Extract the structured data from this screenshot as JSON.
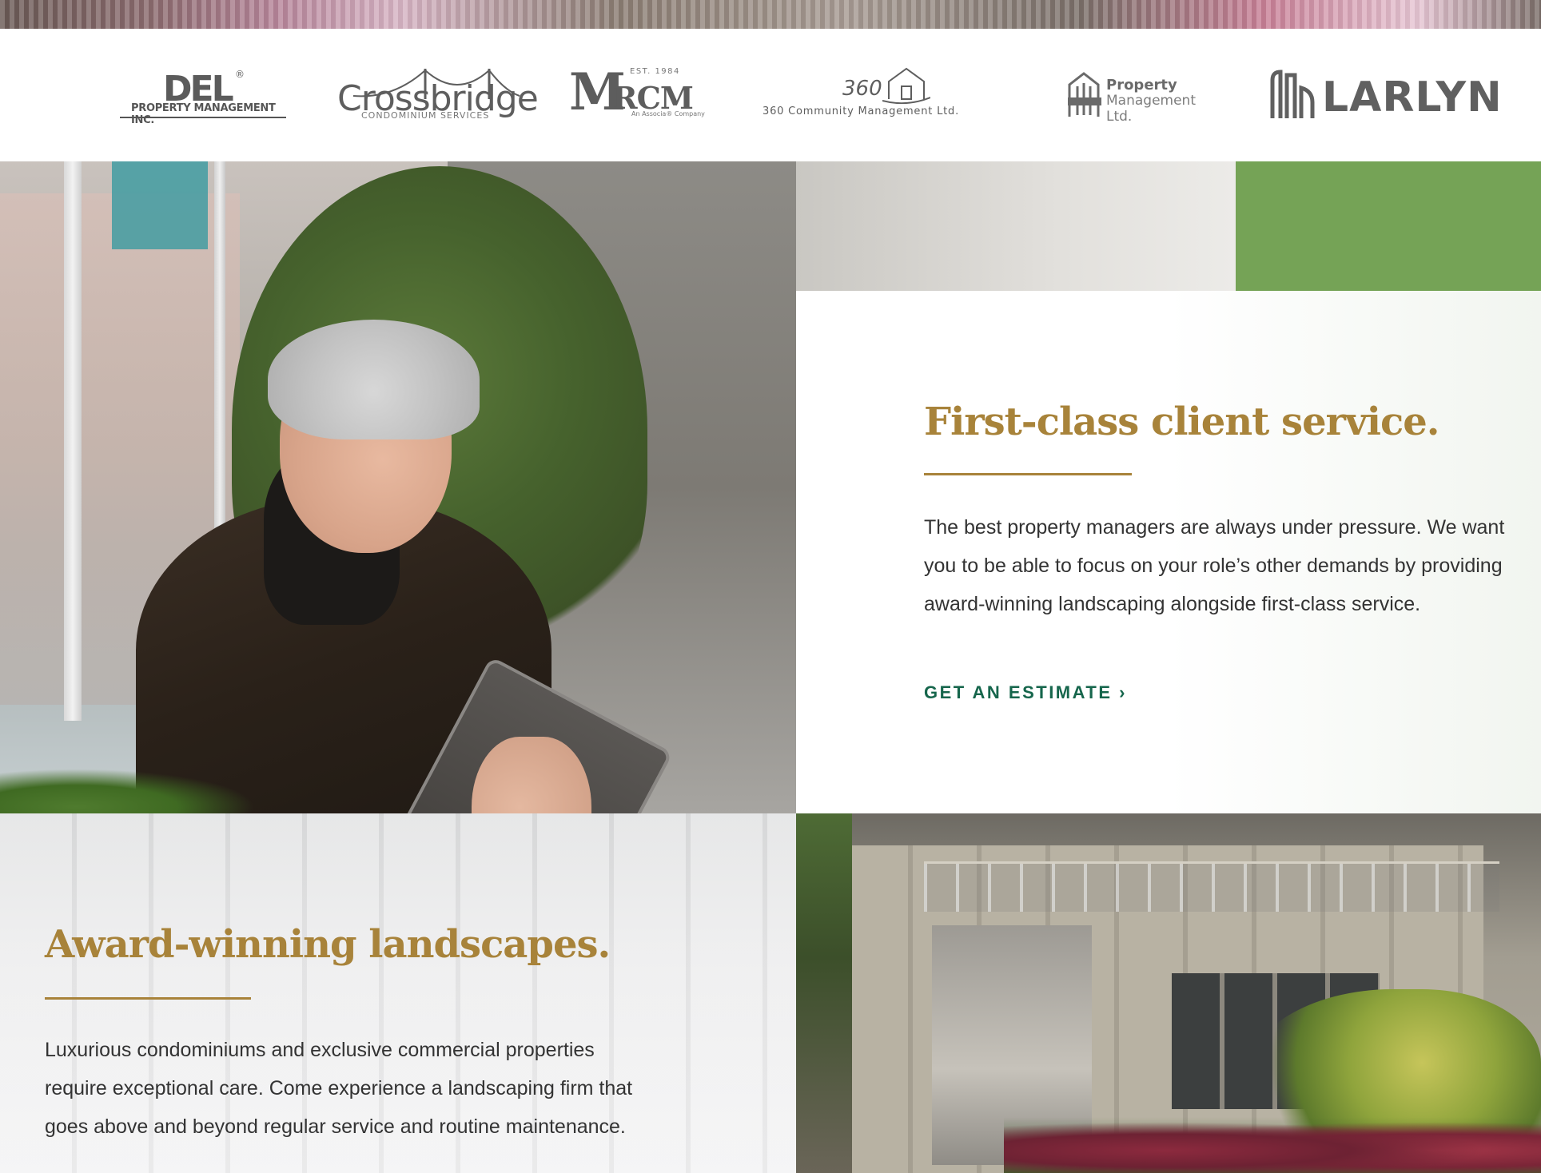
{
  "logos": {
    "del": {
      "mark": "DEL",
      "reg": "®",
      "tagline": "PROPERTY MANAGEMENT INC."
    },
    "crossbridge": {
      "name": "Crossbridge",
      "sub": "CONDOMINIUM SERVICES"
    },
    "mrcm": {
      "m": "M",
      "rcm": "RCM",
      "est": "EST. 1984",
      "assoc": "An Associa® Company"
    },
    "c360": {
      "num": "360",
      "name": "360 Community Management Ltd."
    },
    "icc": {
      "line1": "Property",
      "line2": "Management Ltd."
    },
    "larlyn": {
      "name": "LARLYN"
    }
  },
  "section_service": {
    "heading": "First-class client service.",
    "body": "The best property managers are always under pressure. We want you to be able to focus on your role’s other demands by providing award-winning landscaping alongside first-class service.",
    "cta_label": "GET AN ESTIMATE ›"
  },
  "section_landscapes": {
    "heading": "Award-winning landscapes.",
    "body": "Luxurious condominiums and exclusive commercial properties require exceptional care. Come experience a landscaping firm that goes above and beyond regular service and routine maintenance."
  },
  "colors": {
    "gold": "#a8833a",
    "green_accent": "#75a356",
    "cta_green": "#16664c"
  }
}
